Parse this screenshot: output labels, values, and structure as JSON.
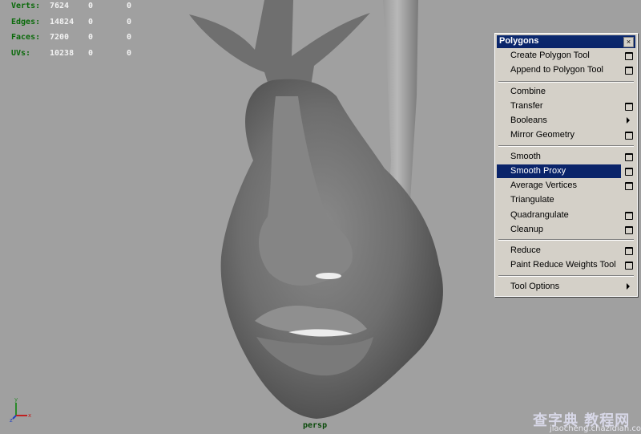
{
  "hud": {
    "rows": [
      {
        "label": "Verts:",
        "v1": "7624",
        "v2": "0",
        "v3": "0"
      },
      {
        "label": "Edges:",
        "v1": "14824",
        "v2": "0",
        "v3": "0"
      },
      {
        "label": "Faces:",
        "v1": "7200",
        "v2": "0",
        "v3": "0"
      },
      {
        "label": "UVs:",
        "v1": "10238",
        "v2": "0",
        "v3": "0"
      }
    ]
  },
  "camera_label": "persp",
  "axis": {
    "y": "y",
    "x": "x",
    "z": "z",
    "y_color": "#2a8a2a",
    "x_color": "#c02020",
    "z_color": "#2040c0"
  },
  "menu": {
    "title": "Polygons",
    "close": "×",
    "items": [
      {
        "label": "Create Polygon Tool",
        "marker": "option"
      },
      {
        "label": "Append to Polygon Tool",
        "marker": "option"
      },
      {
        "label": "Combine",
        "marker": "none"
      },
      {
        "label": "Transfer",
        "marker": "option"
      },
      {
        "label": "Booleans",
        "marker": "submenu"
      },
      {
        "label": "Mirror Geometry",
        "marker": "option"
      },
      {
        "label": "Smooth",
        "marker": "option"
      },
      {
        "label": "Smooth Proxy",
        "marker": "option",
        "highlighted": true
      },
      {
        "label": "Average Vertices",
        "marker": "option"
      },
      {
        "label": "Triangulate",
        "marker": "none"
      },
      {
        "label": "Quadrangulate",
        "marker": "option"
      },
      {
        "label": "Cleanup",
        "marker": "option"
      },
      {
        "label": "Reduce",
        "marker": "option"
      },
      {
        "label": "Paint Reduce Weights Tool",
        "marker": "option"
      },
      {
        "label": "Tool Options",
        "marker": "submenu"
      }
    ],
    "highlight_color": "#0a246a"
  },
  "watermark": {
    "chinese": "查字典 教程网",
    "url": "jiaocheng.chazidian.com"
  }
}
